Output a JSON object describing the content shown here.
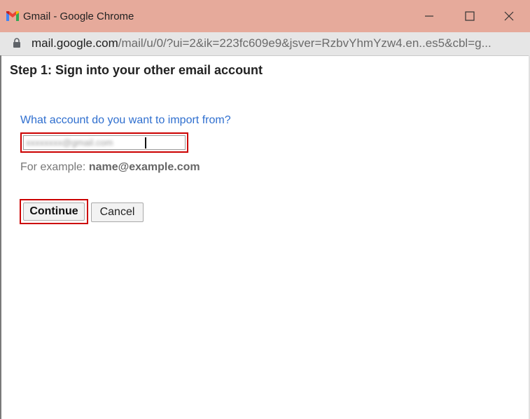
{
  "window": {
    "title": "Gmail - Google Chrome",
    "controls": [
      "minimize-icon",
      "maximize-icon",
      "close-icon"
    ]
  },
  "address_bar": {
    "url_host": "mail.google.com",
    "url_rest": "/mail/u/0/?ui=2&ik=223fc609e9&jsver=RzbvYhmYzw4.en..es5&cbl=g..."
  },
  "dialog": {
    "title": "Step 1: Sign into your other email account",
    "question": "What account do you want to import from?",
    "input_value": "xxxxxxxx@gmail.com",
    "example_prefix": "For example:",
    "example_value": "name@example.com",
    "continue_label": "Continue",
    "cancel_label": "Cancel"
  },
  "colors": {
    "titlebar": "#e6aa9b",
    "link_blue": "#2f6fcf",
    "highlight_red": "#cc0000"
  }
}
